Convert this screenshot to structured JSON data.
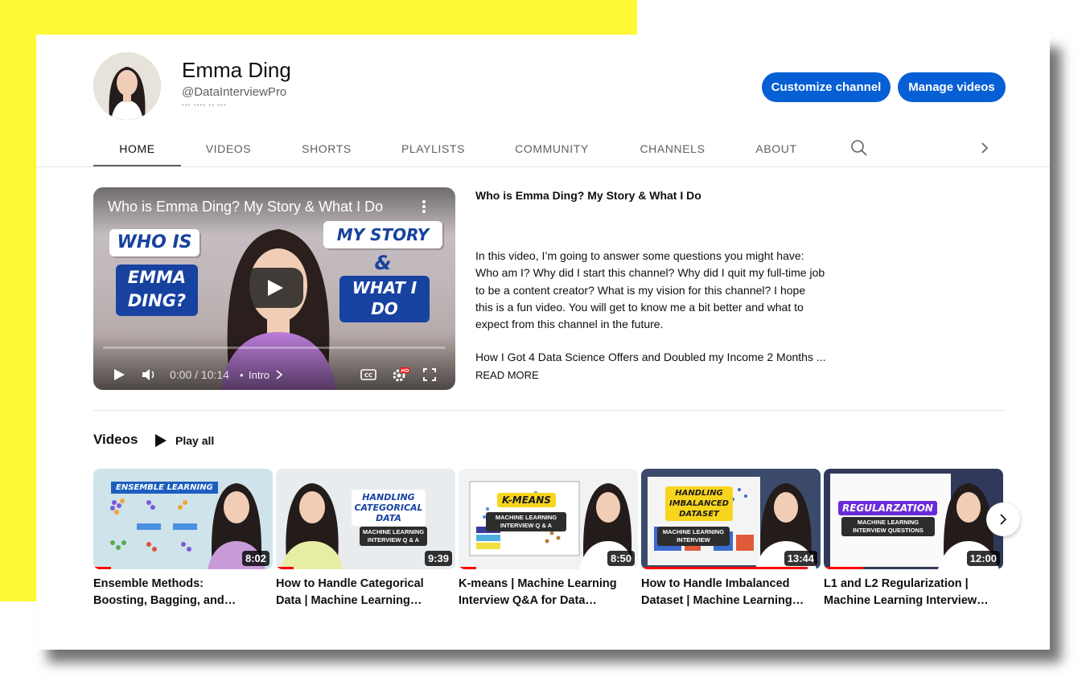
{
  "channel": {
    "name": "Emma Ding",
    "handle": "@DataInterviewPro",
    "customize_label": "Customize channel",
    "manage_label": "Manage videos"
  },
  "tabs": [
    {
      "label": "HOME",
      "active": true
    },
    {
      "label": "VIDEOS"
    },
    {
      "label": "SHORTS"
    },
    {
      "label": "PLAYLISTS"
    },
    {
      "label": "COMMUNITY"
    },
    {
      "label": "CHANNELS"
    },
    {
      "label": "ABOUT"
    }
  ],
  "featured": {
    "player_title": "Who is Emma Ding? My Story & What I Do",
    "time": "0:00 / 10:14",
    "chapter": "Intro",
    "thumb_left_1": "WHO IS",
    "thumb_left_2": "EMMA DING?",
    "thumb_right_1": "MY STORY",
    "thumb_right_amp": "&",
    "thumb_right_2": "WHAT I DO",
    "title": "Who is Emma Ding? My Story & What I Do",
    "description_lines": [
      "In this video, I’m going to answer some questions you might have:",
      "Who am I? Why did I start this channel? Why did I quit my full-time job",
      "to be a content creator?  What is my vision for this channel? I hope",
      "this is a fun video. You will get to know me a bit better and what to",
      "expect from this channel in the future."
    ],
    "link_line": "How I Got 4 Data Science Offers and Doubled my Income 2 Months ...",
    "read_more": "READ MORE"
  },
  "shelf": {
    "title": "Videos",
    "play_all": "Play all",
    "videos": [
      {
        "title_1": "Ensemble Methods:",
        "title_2": "Boosting, Bagging, and…",
        "duration": "8:02",
        "thumb_label": "ENSEMBLE LEARNING",
        "watched": 0.1,
        "bg": "#cfe3ea"
      },
      {
        "title_1": "How to Handle Categorical",
        "title_2": "Data | Machine Learning…",
        "duration": "9:39",
        "thumb_label": "HANDLING CATEGORICAL DATA",
        "thumb_sub": "MACHINE LEARNING INTERVIEW Q & A",
        "watched": 0.1,
        "bg": "#e9ecef"
      },
      {
        "title_1": "K-means | Machine Learning",
        "title_2": "Interview Q&A for Data…",
        "duration": "8:50",
        "thumb_label": "K-MEANS",
        "thumb_sub": "MACHINE LEARNING INTERVIEW Q & A",
        "watched": 0.1,
        "bg": "#f0f2f4"
      },
      {
        "title_1": "How to Handle Imbalanced",
        "title_2": "Dataset | Machine Learning…",
        "duration": "13:44",
        "thumb_label": "HANDLING IMBALANCED DATASET",
        "thumb_sub": "MACHINE LEARNING INTERVIEW",
        "watched": 0.93,
        "bg": "#3b4a6b"
      },
      {
        "title_1": "L1 and L2 Regularization |",
        "title_2": "Machine Learning Interview…",
        "duration": "12:00",
        "thumb_label": "REGULARZATION",
        "thumb_sub": "MACHINE LEARNING INTERVIEW QUESTIONS",
        "watched": 0.22,
        "bg": "#31395a"
      }
    ]
  },
  "colors": {
    "accent": "#065fd4",
    "highlight": "#fff935",
    "progress_red": "#ff0000"
  },
  "icons": [
    "search-icon",
    "chevron-right-icon",
    "more-vert-icon",
    "play-icon",
    "volume-icon",
    "captions-icon",
    "settings-icon",
    "fullscreen-icon",
    "play-all-icon"
  ]
}
